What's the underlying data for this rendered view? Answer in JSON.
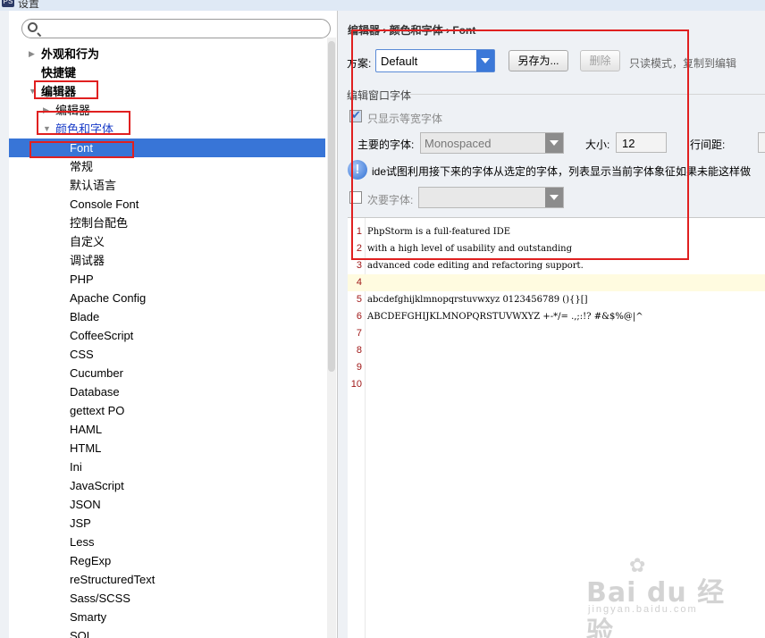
{
  "window": {
    "title": "设置"
  },
  "sidebar": {
    "search": {
      "placeholder": ""
    },
    "items": [
      {
        "label": "外观和行为",
        "level": 0,
        "arrow": "▶"
      },
      {
        "label": "快捷键",
        "level": 0,
        "arrow": ""
      },
      {
        "label": "编辑器",
        "level": 0,
        "arrow": "▼"
      },
      {
        "label": "编辑器",
        "level": 1,
        "arrow": "▶"
      },
      {
        "label": "颜色和字体",
        "level": 1,
        "arrow": "▼"
      },
      {
        "label": "Font",
        "level": 2,
        "selected": true
      },
      {
        "label": "常规",
        "level": 2
      },
      {
        "label": "默认语言",
        "level": 2
      },
      {
        "label": "Console Font",
        "level": 2
      },
      {
        "label": "控制台配色",
        "level": 2
      },
      {
        "label": "自定义",
        "level": 2
      },
      {
        "label": "调试器",
        "level": 2
      },
      {
        "label": "PHP",
        "level": 2
      },
      {
        "label": "Apache Config",
        "level": 2
      },
      {
        "label": "Blade",
        "level": 2
      },
      {
        "label": "CoffeeScript",
        "level": 2
      },
      {
        "label": "CSS",
        "level": 2
      },
      {
        "label": "Cucumber",
        "level": 2
      },
      {
        "label": "Database",
        "level": 2
      },
      {
        "label": "gettext PO",
        "level": 2
      },
      {
        "label": "HAML",
        "level": 2
      },
      {
        "label": "HTML",
        "level": 2
      },
      {
        "label": "Ini",
        "level": 2
      },
      {
        "label": "JavaScript",
        "level": 2
      },
      {
        "label": "JSON",
        "level": 2
      },
      {
        "label": "JSP",
        "level": 2
      },
      {
        "label": "Less",
        "level": 2
      },
      {
        "label": "RegExp",
        "level": 2
      },
      {
        "label": "reStructuredText",
        "level": 2
      },
      {
        "label": "Sass/SCSS",
        "level": 2
      },
      {
        "label": "Smarty",
        "level": 2
      },
      {
        "label": "SQL",
        "level": 2
      }
    ]
  },
  "main": {
    "breadcrumb": "编辑器 › 颜色和字体 › Font",
    "scheme": {
      "label": "方案:",
      "value": "Default",
      "save_as_label": "另存为...",
      "delete_label": "删除",
      "readonly_note": "只读模式，复制到编辑"
    },
    "editor_font": {
      "section_title": "编辑窗口字体",
      "monospaced_only_label": "只显示等宽字体",
      "monospaced_only_checked": true,
      "primary_label": "主要的字体:",
      "primary_value": "Monospaced",
      "size_label": "大小:",
      "size_value": "12",
      "line_spacing_label": "行间距:",
      "info_text": "ide试图利用接下来的字体从选定的字体，列表显示当前字体象征如果未能这样做",
      "secondary_label": "次要字体:",
      "secondary_checked": false,
      "secondary_value": ""
    },
    "preview": {
      "caret_line": 4,
      "lines": [
        {
          "n": "1",
          "text": "PhpStorm is a full-featured IDE"
        },
        {
          "n": "2",
          "text": "with a high level of usability and outstanding"
        },
        {
          "n": "3",
          "text": "advanced code editing and refactoring support."
        },
        {
          "n": "4",
          "text": ""
        },
        {
          "n": "5",
          "text": "abcdefghijklmnopqrstuvwxyz 0123456789 (){}[]"
        },
        {
          "n": "6",
          "text": "ABCDEFGHIJKLMNOPQRSTUVWXYZ +-*/= .,;:!? #&$%@|^"
        },
        {
          "n": "7",
          "text": ""
        },
        {
          "n": "8",
          "text": ""
        },
        {
          "n": "9",
          "text": ""
        },
        {
          "n": "10",
          "text": ""
        }
      ]
    }
  },
  "watermark": {
    "brand": "Bai du 经验",
    "url": "jingyan.baidu.com"
  },
  "colors": {
    "selection": "#3875d7",
    "annotation": "#e02020",
    "line_number": "#a01818"
  }
}
